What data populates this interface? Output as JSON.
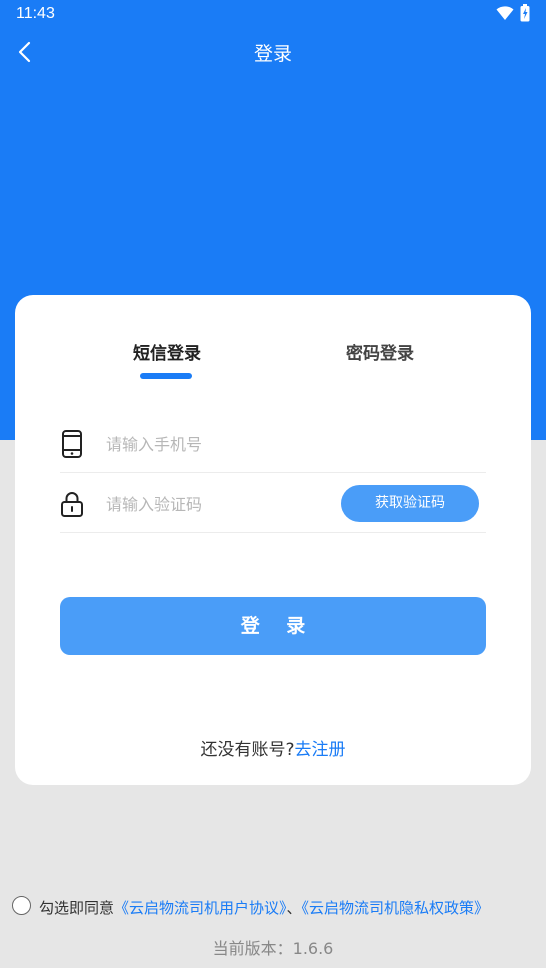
{
  "status_bar": {
    "time": "11:43"
  },
  "nav": {
    "title": "登录"
  },
  "tabs": [
    {
      "label": "短信登录",
      "active": true
    },
    {
      "label": "密码登录",
      "active": false
    }
  ],
  "form": {
    "phone_placeholder": "请输入手机号",
    "phone_value": "",
    "code_placeholder": "请输入验证码",
    "code_value": "",
    "get_code_label": "获取验证码",
    "login_label": "登 录"
  },
  "register": {
    "prompt": "还没有账号?",
    "link": "去注册"
  },
  "agreement": {
    "prefix": "勾选即同意",
    "user_agreement": "《云启物流司机用户协议》",
    "separator": "、",
    "privacy_policy": "《云启物流司机隐私权政策》"
  },
  "version": {
    "text": "当前版本：1.6.6"
  },
  "colors": {
    "primary": "#1a7cf6",
    "button": "#4a9df8",
    "background": "#e6e6e6"
  },
  "icons": {
    "back": "back-arrow-icon",
    "phone": "phone-icon",
    "lock": "lock-icon",
    "wifi": "wifi-icon",
    "battery": "battery-icon"
  }
}
